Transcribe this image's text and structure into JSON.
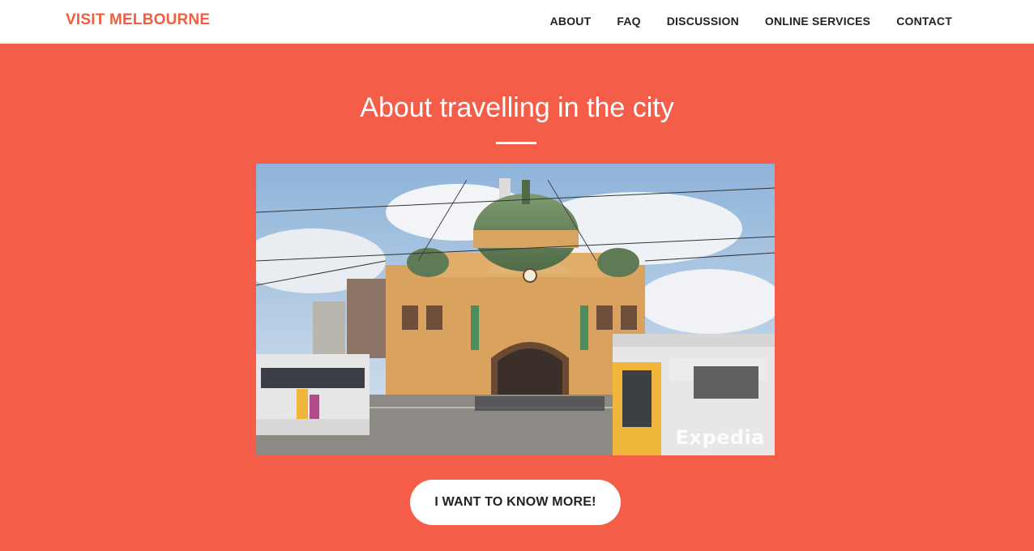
{
  "nav": {
    "brand": "VISIT MELBOURNE",
    "links": [
      "ABOUT",
      "FAQ",
      "DISCUSSION",
      "ONLINE SERVICES",
      "CONTACT"
    ]
  },
  "hero": {
    "title": "About travelling in the city",
    "video_watermark": "Expedia",
    "cta_label": "I WANT TO KNOW MORE!"
  },
  "colors": {
    "accent": "#f45d48",
    "brand_text": "#f05f40",
    "white": "#ffffff"
  }
}
